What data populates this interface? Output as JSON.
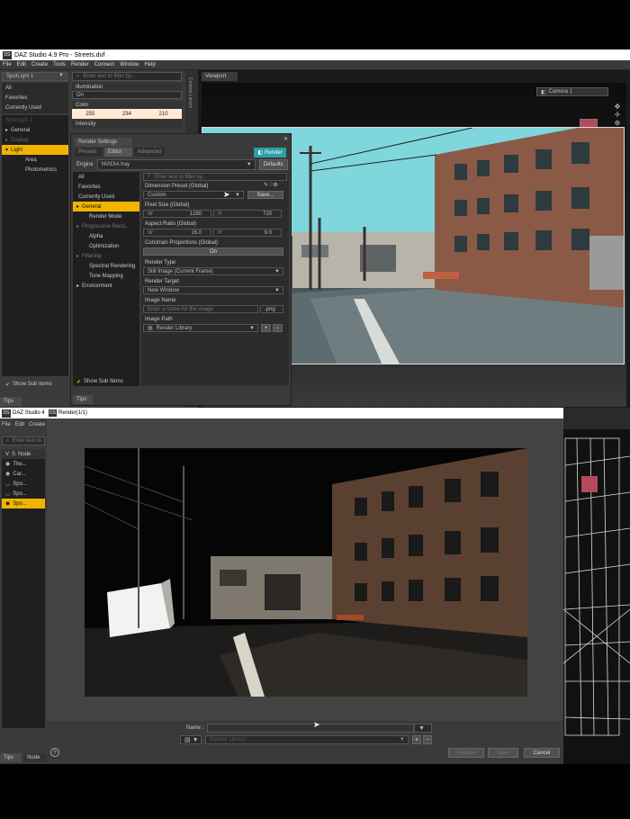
{
  "top_window": {
    "title": "DAZ Studio 4.9 Pro - Streets.duf",
    "menu": [
      "File",
      "Edit",
      "Create",
      "Tools",
      "Render",
      "Connect",
      "Window",
      "Help"
    ],
    "node_selector": "SpotLight 1",
    "categories": [
      "All",
      "Favorites",
      "Currently Used"
    ],
    "tree": [
      "SpotLight 1",
      "General",
      "Display",
      "Light",
      "Area",
      "Photometrics"
    ],
    "search_placeholder": "Enter text to filter by...",
    "illumination": {
      "label": "Illumination",
      "value": "On"
    },
    "color": {
      "label": "Color",
      "r": "255",
      "g": "234",
      "b": "210"
    },
    "intensity_label": "Intensity",
    "show_sub_items": "Show Sub Items",
    "tips": "Tips",
    "viewport_tab": "Viewport",
    "camera": "Camera 1",
    "side_tab": "Content Library"
  },
  "render_settings": {
    "title": "Render Settings",
    "render_button": "Render",
    "tabs": [
      "Presets",
      "Editor",
      "Advanced"
    ],
    "engine_label": "Engine",
    "engine_value": "NVIDIA Iray",
    "defaults": "Defaults",
    "filter_placeholder": "Enter text to filter by...",
    "categories": [
      "All",
      "Favorites",
      "Currently Used",
      "General",
      "Render Mode",
      "Progressive Rend...",
      "Alpha",
      "Optimization",
      "Filtering",
      "Spectral Rendering",
      "Tone Mapping",
      "Environment"
    ],
    "dimension_preset": {
      "label": "Dimension Preset (Global)",
      "value": "Custom",
      "save": "Save..."
    },
    "pixel_size": {
      "label": "Pixel Size (Global)",
      "w_label": "W",
      "w": "1280",
      "h_label": "H",
      "h": "720"
    },
    "aspect_ratio": {
      "label": "Aspect Ratio (Global)",
      "w_label": "W",
      "w": "16.0",
      "h_label": "H",
      "h": "9.0"
    },
    "constrain": {
      "label": "Constrain Proportions (Global)",
      "value": "On"
    },
    "render_type": {
      "label": "Render Type",
      "value": "Still Image (Current Frame)"
    },
    "render_target": {
      "label": "Render Target",
      "value": "New Window"
    },
    "image_name": {
      "label": "Image Name",
      "placeholder": "Enter a name for the image",
      "ext": ".png"
    },
    "image_path": {
      "label": "Image Path",
      "value": "Render Library"
    },
    "show_sub_items": "Show Sub Items",
    "tips": "Tips"
  },
  "bottom_window": {
    "title": "DAZ Studio 4",
    "menu": [
      "File",
      "Edit",
      "Create"
    ],
    "search_placeholder": "Enter text to",
    "scene_header": "Node",
    "scene_items": [
      "The...",
      "Car...",
      "Spo...",
      "Spo...",
      "Spo..."
    ],
    "tabs": [
      "Tips",
      "Node"
    ]
  },
  "render_window": {
    "title": "Render(1/1)",
    "name_label": "Name :",
    "path_value": "Render Library",
    "buttons": [
      "Restore",
      "Save",
      "Cancel"
    ]
  },
  "colors": {
    "accent": "#f0b400",
    "teal": "#2aa0a8",
    "panel": "#3b3b3b",
    "titlebar_blue": "#3a86c8"
  }
}
